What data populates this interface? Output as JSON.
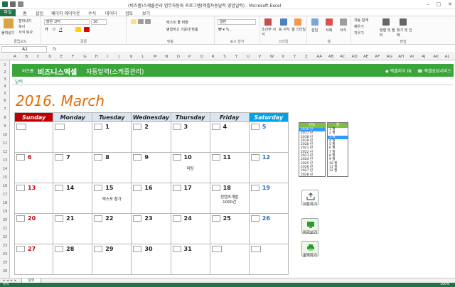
{
  "window": {
    "title": "(비즈폼)스케줄관리 업무자동화 프로그램(엑셀자동달력 영업일력) - Microsoft Excel",
    "controls": [
      "–",
      "□",
      "✕"
    ]
  },
  "ribbon_tabs": [
    "파일",
    "홈",
    "삽입",
    "페이지 레이아웃",
    "수식",
    "데이터",
    "검토",
    "보기"
  ],
  "ribbon": {
    "clipboard": {
      "paste": "붙여넣기",
      "cut": "잘라내기",
      "copy": "복사",
      "format_painter": "서식 복사",
      "label": "클립보드"
    },
    "font": {
      "name": "맑은 고딕",
      "size": "10",
      "label": "글꼴"
    },
    "alignment": {
      "wrap": "텍스트 줄 바꿈",
      "merge": "병합하고 가운데 맞춤",
      "label": "맞춤"
    },
    "number": {
      "format": "일반",
      "label": "표시 형식"
    },
    "styles": {
      "conditional": "조건부 서식",
      "table": "표 서식",
      "cell": "셀 스타일",
      "label": "스타일"
    },
    "cells": {
      "insert": "삽입",
      "delete": "삭제",
      "format": "서식",
      "label": "셀"
    },
    "editing": {
      "autosum": "자동 합계",
      "fill": "채우기",
      "clear": "지우기",
      "sort": "정렬 및 필터",
      "find": "찾기 및 선택",
      "label": "편집"
    }
  },
  "formula_bar": {
    "name_box": "A1",
    "fx": "fx",
    "value": ""
  },
  "columns": [
    "A",
    "B",
    "C",
    "D",
    "E",
    "F",
    "G",
    "H",
    "I",
    "J",
    "K",
    "L",
    "M",
    "N",
    "O",
    "P",
    "Q",
    "R",
    "S",
    "T",
    "U",
    "V",
    "W",
    "X",
    "Y",
    "Z",
    "AA",
    "AB",
    "AC",
    "AD",
    "AE",
    "AF",
    "AG",
    "AH",
    "AI",
    "AJ",
    "AK",
    "AL"
  ],
  "rows": [
    "1",
    "2",
    "3",
    "4",
    "5",
    "6",
    "7",
    "8",
    "9",
    "10",
    "11",
    "12",
    "13",
    "14",
    "15",
    "16",
    "17",
    "18",
    "19",
    "20",
    "21",
    "22",
    "23",
    "24",
    "25",
    "26",
    "27",
    "28",
    "29",
    "30",
    "31",
    "32",
    "33",
    "34",
    "35",
    "36",
    "37"
  ],
  "banner": {
    "brand_small": "비즈폼",
    "brand": "비즈니스엑셀",
    "subtitle": "자동달력(스케줄관리)",
    "link1": "◆ 엑셀지식 IN",
    "link2": "☎ 엑셀상담서비스"
  },
  "breadcrumb": "달력",
  "calendar": {
    "month_title": "2016. March",
    "weekdays": [
      "Sunday",
      "Monday",
      "Tuesday",
      "Wednesday",
      "Thursday",
      "Friday",
      "Saturday"
    ],
    "weeks": [
      [
        {
          "day": "",
          "box": true
        },
        {
          "day": "",
          "box": true
        },
        {
          "day": "1",
          "note": ""
        },
        {
          "day": "2",
          "note": ""
        },
        {
          "day": "3",
          "note": ""
        },
        {
          "day": "4",
          "note": ""
        },
        {
          "day": "5",
          "note": ""
        }
      ],
      [
        {
          "day": "6",
          "note": ""
        },
        {
          "day": "7",
          "note": ""
        },
        {
          "day": "8",
          "note": ""
        },
        {
          "day": "9",
          "note": ""
        },
        {
          "day": "10",
          "note": "미팅"
        },
        {
          "day": "11",
          "note": ""
        },
        {
          "day": "12",
          "note": ""
        }
      ],
      [
        {
          "day": "13",
          "note": ""
        },
        {
          "day": "14",
          "note": ""
        },
        {
          "day": "15",
          "note": "엑스포 참가"
        },
        {
          "day": "16",
          "note": ""
        },
        {
          "day": "17",
          "note": ""
        },
        {
          "day": "18",
          "note": "컨텐츠개발\n1000건"
        },
        {
          "day": "19",
          "note": ""
        }
      ],
      [
        {
          "day": "20",
          "note": ""
        },
        {
          "day": "21",
          "note": ""
        },
        {
          "day": "22",
          "note": ""
        },
        {
          "day": "23",
          "note": ""
        },
        {
          "day": "24",
          "note": ""
        },
        {
          "day": "25",
          "note": ""
        },
        {
          "day": "26",
          "note": ""
        }
      ],
      [
        {
          "day": "27",
          "note": ""
        },
        {
          "day": "28",
          "note": ""
        },
        {
          "day": "29",
          "note": ""
        },
        {
          "day": "30",
          "note": ""
        },
        {
          "day": "31",
          "note": ""
        },
        {
          "day": "",
          "box": true
        },
        {
          "day": "",
          "box": true
        }
      ]
    ]
  },
  "year_list": {
    "header": "년도",
    "items": [
      "2016 년",
      "2017 년",
      "2018 년",
      "2019 년",
      "2020 년",
      "2021 년",
      "2022 년",
      "2023 년",
      "2024 년",
      "2025 년",
      "2026 년",
      "2027 년",
      "2028 년"
    ],
    "selected": 0
  },
  "month_list": {
    "header": "월",
    "items": [
      "1 월",
      "2 월",
      "3 월",
      "4 월",
      "5 월",
      "6 월",
      "7 월",
      "8 월",
      "9 월",
      "10 월",
      "11 월",
      "12 월"
    ],
    "selected": 2
  },
  "side_buttons": {
    "save": "저장하기",
    "preview": "미리보기",
    "print": "출력하기"
  },
  "sheet_tab": "달력",
  "status": {
    "ready": "준비",
    "zoom": "100%"
  }
}
